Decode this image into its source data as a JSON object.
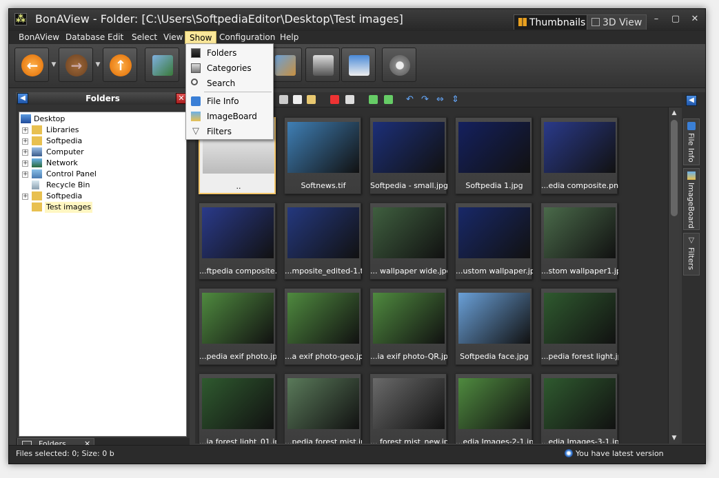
{
  "window": {
    "title": "BonAView - Folder: [C:\\Users\\SoftpediaEditor\\Desktop\\Test images]",
    "view_tabs": [
      "Thumbnails",
      "3D View"
    ],
    "controls": {
      "minimize": "–",
      "maximize": "▢",
      "close": "✕"
    }
  },
  "menu": [
    "BonAView",
    "Database",
    "Edit",
    "Select",
    "View",
    "Show",
    "Configuration",
    "Help"
  ],
  "show_menu": {
    "items": [
      {
        "label": "Folders",
        "icon": "monitor-icon"
      },
      {
        "label": "Categories",
        "icon": "categories-icon"
      },
      {
        "label": "Search",
        "icon": "search-icon"
      },
      {
        "label": "File Info",
        "icon": "info-icon"
      },
      {
        "label": "ImageBoard",
        "icon": "imageboard-icon"
      },
      {
        "label": "Filters",
        "icon": "filter-icon"
      }
    ]
  },
  "left_panel": {
    "title": "Folders",
    "tree": [
      {
        "label": "Desktop",
        "expander": ""
      },
      {
        "label": "Libraries",
        "expander": "+"
      },
      {
        "label": "Softpedia",
        "expander": "+"
      },
      {
        "label": "Computer",
        "expander": "+"
      },
      {
        "label": "Network",
        "expander": "+"
      },
      {
        "label": "Control Panel",
        "expander": "+"
      },
      {
        "label": "Recycle Bin",
        "expander": ""
      },
      {
        "label": "Softpedia",
        "expander": "+"
      },
      {
        "label": "Test images",
        "expander": ""
      }
    ],
    "footer_tab": "Folders",
    "footer_close": "✕"
  },
  "thumbnails": [
    {
      "caption": "..",
      "color": "#dcdcdc"
    },
    {
      "caption": "Softnews.tif",
      "color": "#3f7fb5"
    },
    {
      "caption": "Softpedia  - small.jpg",
      "color": "#1c2f78"
    },
    {
      "caption": "Softpedia 1.jpg",
      "color": "#14205e"
    },
    {
      "caption": "...edia composite.png",
      "color": "#2a3a8a"
    },
    {
      "caption": "...ftpedia composite.tif",
      "color": "#2a3a8a"
    },
    {
      "caption": "...mposite_edited-1.tif",
      "color": "#24387e"
    },
    {
      "caption": "... wallpaper wide.jpg",
      "color": "#3f5f3f"
    },
    {
      "caption": "...ustom wallpaper.jpg",
      "color": "#182868"
    },
    {
      "caption": "...stom wallpaper1.jpg",
      "color": "#4a6a4a"
    },
    {
      "caption": "...pedia exif photo.jpg",
      "color": "#4f8a3f"
    },
    {
      "caption": "...a exif photo-geo.jpg",
      "color": "#4f8a3f"
    },
    {
      "caption": "...ia exif photo-QR.jpg",
      "color": "#4f8a3f"
    },
    {
      "caption": "Softpedia face.jpg",
      "color": "#6aa0d8"
    },
    {
      "caption": "...pedia forest light.jpg",
      "color": "#2f5a2f"
    },
    {
      "caption": "...ia forest light_01.jpg",
      "color": "#2f5a2f"
    },
    {
      "caption": "...pedia forest mist.jpg",
      "color": "#5a7a5a"
    },
    {
      "caption": "... forest mist_new.jpg",
      "color": "#6a6a6a"
    },
    {
      "caption": "...edia Images-2-1.jpg",
      "color": "#4f8a3f"
    },
    {
      "caption": "...edia Images-3-1.jpg",
      "color": "#2f5a2f"
    }
  ],
  "right_tabs": [
    "File Info",
    "ImageBoard",
    "Filters"
  ],
  "status": {
    "left": "Files selected: 0; Size: 0 b",
    "right": "You have latest version"
  }
}
